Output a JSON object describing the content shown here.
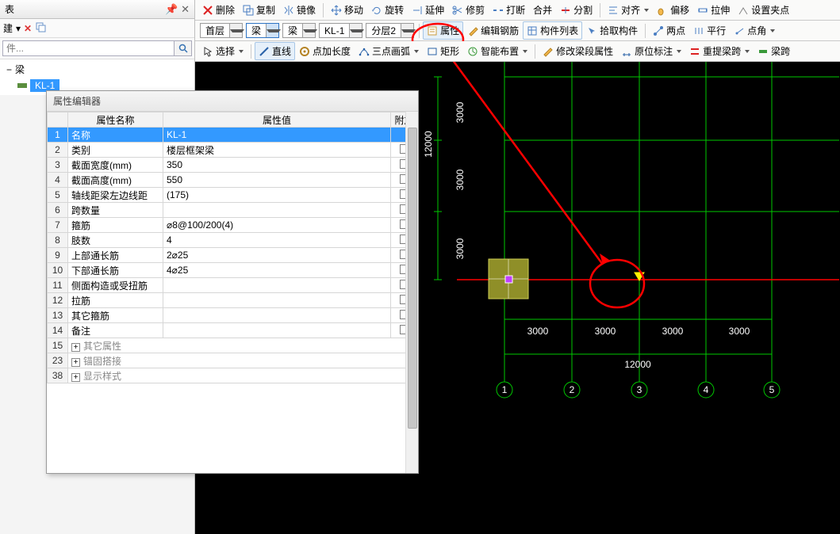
{
  "toolbar1": {
    "delete": "删除",
    "copy": "复制",
    "mirror": "镜像",
    "move": "移动",
    "rotate": "旋转",
    "extend": "延伸",
    "trim": "修剪",
    "break": "打断",
    "join": "合并",
    "split": "分割",
    "align": "对齐",
    "offset": "偏移",
    "stretch": "拉伸",
    "snap": "设置夹点"
  },
  "toolbar2": {
    "floor": "首层",
    "cat1": "梁",
    "cat2": "梁",
    "member": "KL-1",
    "layer": "分层2",
    "prop": "属性",
    "editbar": "编辑钢筋",
    "memberlist": "构件列表",
    "pick": "拾取构件",
    "twopt": "两点",
    "parallel": "平行",
    "pointangle": "点角"
  },
  "toolbar3": {
    "select": "选择",
    "line": "直线",
    "ptlen": "点加长度",
    "arc3": "三点画弧",
    "rect": "矩形",
    "smartlay": "智能布置",
    "beamseg": "修改梁段属性",
    "origin": "原位标注",
    "respan": "重提梁跨",
    "beamsp": "梁跨"
  },
  "left": {
    "panel1": "表",
    "new": "建",
    "search_ph": "件...",
    "tree_root": "梁",
    "tree_item": "KL-1"
  },
  "prop": {
    "title": "属性编辑器",
    "col_name": "属性名称",
    "col_val": "属性值",
    "col_add": "附加",
    "rows": [
      {
        "n": "1",
        "name": "名称",
        "val": "KL-1",
        "sel": true,
        "ck": false
      },
      {
        "n": "2",
        "name": "类别",
        "val": "楼层框架梁",
        "ck": true
      },
      {
        "n": "3",
        "name": "截面宽度(mm)",
        "val": "350",
        "ck": true
      },
      {
        "n": "4",
        "name": "截面高度(mm)",
        "val": "550",
        "ck": true
      },
      {
        "n": "5",
        "name": "轴线距梁左边线距",
        "val": "(175)",
        "ck": true
      },
      {
        "n": "6",
        "name": "跨数量",
        "val": "",
        "ck": true
      },
      {
        "n": "7",
        "name": "箍筋",
        "val": "⌀8@100/200(4)",
        "ck": true
      },
      {
        "n": "8",
        "name": "肢数",
        "val": "4",
        "ck": true
      },
      {
        "n": "9",
        "name": "上部通长筋",
        "val": "2⌀25",
        "ck": true
      },
      {
        "n": "10",
        "name": "下部通长筋",
        "val": "4⌀25",
        "ck": true
      },
      {
        "n": "11",
        "name": "侧面构造或受扭筋",
        "val": "",
        "ck": true
      },
      {
        "n": "12",
        "name": "拉筋",
        "val": "",
        "ck": true
      },
      {
        "n": "13",
        "name": "其它箍筋",
        "val": "",
        "ck": true
      },
      {
        "n": "14",
        "name": "备注",
        "val": "",
        "ck": true
      }
    ],
    "groups": [
      {
        "n": "15",
        "name": "其它属性"
      },
      {
        "n": "23",
        "name": "锚固搭接"
      },
      {
        "n": "38",
        "name": "显示样式"
      }
    ]
  },
  "canvas": {
    "vdims": [
      "3000",
      "3000",
      "3000"
    ],
    "hdims": [
      "3000",
      "3000",
      "3000",
      "3000"
    ],
    "total": "12000",
    "span": "12000",
    "bubbles": [
      "1",
      "2",
      "3",
      "4",
      "5"
    ]
  }
}
